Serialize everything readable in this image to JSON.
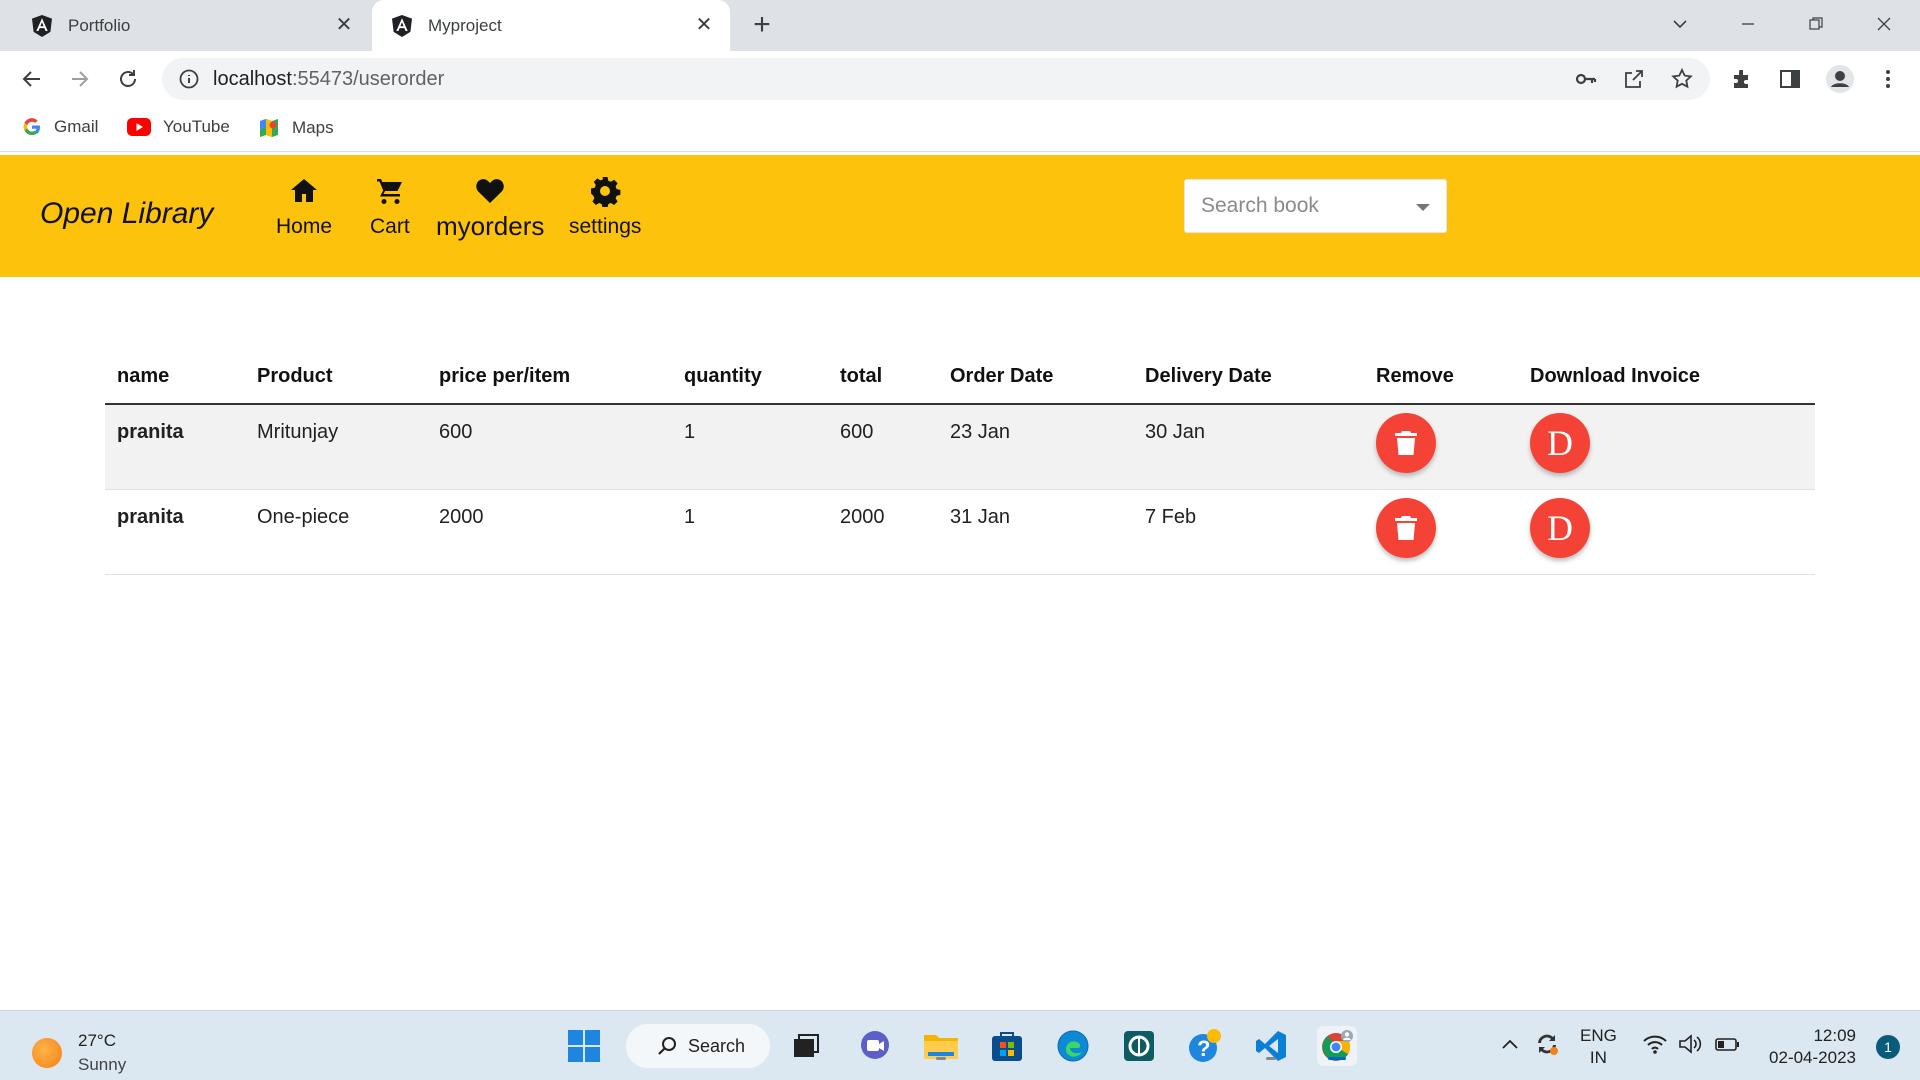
{
  "browser": {
    "tabs": [
      {
        "title": "Portfolio",
        "active": false
      },
      {
        "title": "Myproject",
        "active": true
      }
    ],
    "url_host": "localhost",
    "url_path": ":55473/userorder",
    "bookmarks": [
      "Gmail",
      "YouTube",
      "Maps"
    ]
  },
  "app": {
    "brand": "Open Library",
    "nav": [
      {
        "label": "Home",
        "icon": "home-icon"
      },
      {
        "label": "Cart",
        "icon": "cart-icon"
      },
      {
        "label": "myorders",
        "icon": "heart-icon"
      },
      {
        "label": "settings",
        "icon": "gear-icon"
      }
    ],
    "search_placeholder": "Search book",
    "accent": "#fdc20b",
    "fab_color": "#f44336"
  },
  "orders": {
    "headers": [
      "name",
      "Product",
      "price per/item",
      "quantity",
      "total",
      "Order Date",
      "Delivery Date",
      "Remove",
      "Download Invoice"
    ],
    "rows": [
      {
        "name": "pranita",
        "product": "Mritunjay",
        "price": "600",
        "quantity": "1",
        "total": "600",
        "order_date": "23 Jan",
        "delivery_date": "30 Jan",
        "invoice_label": "D"
      },
      {
        "name": "pranita",
        "product": "One-piece",
        "price": "2000",
        "quantity": "1",
        "total": "2000",
        "order_date": "31 Jan",
        "delivery_date": "7 Feb",
        "invoice_label": "D"
      }
    ]
  },
  "taskbar": {
    "weather_temp": "27°C",
    "weather_cond": "Sunny",
    "search_label": "Search",
    "lang_1": "ENG",
    "lang_2": "IN",
    "time": "12:09",
    "date": "02-04-2023",
    "notifications": "1"
  }
}
